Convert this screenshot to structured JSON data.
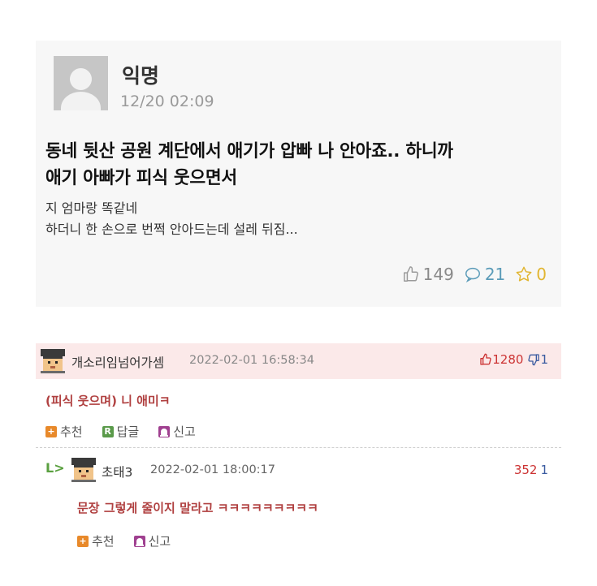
{
  "post": {
    "author": "익명",
    "date": "12/20 02:09",
    "title_line1": "동네 뒷산 공원 계단에서 애기가 압빠 나 안아죠.. 하니까",
    "title_line2": "애기 아빠가 피식 웃으면서",
    "body_line1": "지 엄마랑 똑같네",
    "body_line2": "하더니 한 손으로 번쩍 안아드는데 설레 뒤짐...",
    "likes": "149",
    "comments": "21",
    "stars": "0"
  },
  "comments": [
    {
      "nickname": "개소리임넘어가셈",
      "date": "2022-02-01 16:58:34",
      "upvotes": "1280",
      "downvotes": "1",
      "text": "(피식 웃으며) 니 애미ㅋ",
      "actions": {
        "recommend": "추천",
        "reply": "답글",
        "report": "신고"
      }
    },
    {
      "reply_marker": "L>",
      "nickname": "초태3",
      "date": "2022-02-01 18:00:17",
      "upvotes": "352",
      "downvotes": "1",
      "text": "문장 그렇게 줄이지 말라고 ㅋㅋㅋㅋㅋㅋㅋㅋㅋ",
      "actions": {
        "recommend": "추천",
        "report": "신고"
      }
    }
  ],
  "icons": {
    "recommend_badge": "+",
    "reply_badge": "R",
    "report_badge": "siren-icon"
  },
  "colors": {
    "comment_text": "#b04040",
    "highlight_row": "#fbe9e9",
    "upvote": "#cc3333",
    "downvote": "#3a5ba0",
    "comment_count": "#5a9bb8",
    "star": "#e1b530"
  }
}
